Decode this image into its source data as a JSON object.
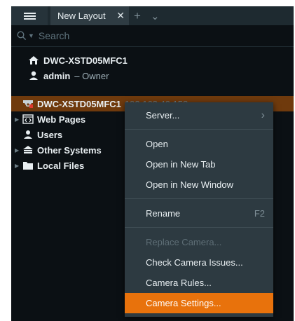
{
  "titlebar": {
    "tab_label": "New Layout",
    "tab_close": "✕",
    "add_tab": "+",
    "tab_list": "⌄"
  },
  "search": {
    "placeholder": "Search"
  },
  "server": {
    "name": "DWC-XSTD05MFC1",
    "user": "admin",
    "role": "– Owner"
  },
  "tree": {
    "camera_name": "DWC-XSTD05MFC1",
    "camera_ip": "192.168.40.158",
    "items": [
      {
        "label": "Web Pages"
      },
      {
        "label": "Users"
      },
      {
        "label": "Other Systems"
      },
      {
        "label": "Local Files"
      }
    ]
  },
  "context_menu": {
    "items": [
      {
        "label": "Server...",
        "side": "›"
      },
      {
        "label": "Open"
      },
      {
        "label": "Open in New Tab"
      },
      {
        "label": "Open in New Window"
      },
      {
        "label": "Rename",
        "side": "F2"
      },
      {
        "label": "Replace Camera..."
      },
      {
        "label": "Check Camera Issues..."
      },
      {
        "label": "Camera Rules..."
      },
      {
        "label": "Camera Settings..."
      }
    ]
  },
  "colors": {
    "accent": "#e8720c",
    "selection": "#6f3a0d",
    "background": "#0b1014",
    "menu_bg": "#2d3a41"
  }
}
